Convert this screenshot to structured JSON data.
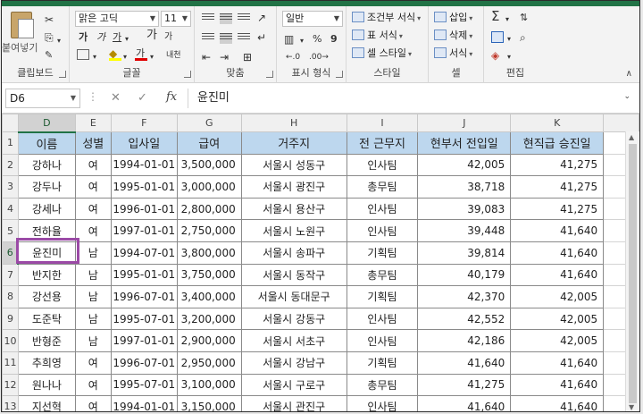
{
  "ribbon": {
    "clipboard": {
      "paste_label": "붙여넣기",
      "cut_icon": "✂",
      "copy_icon": "⎘",
      "painter_icon": "🖌",
      "group_label": "클립보드"
    },
    "font": {
      "font_name": "맑은 고딕",
      "font_size": "11",
      "bold": "가",
      "italic": "가",
      "underline": "가",
      "grow": "가",
      "shrink": "가",
      "font_color_glyph": "가",
      "phonetic": "내천",
      "group_label": "글꼴"
    },
    "alignment": {
      "group_label": "맞춤"
    },
    "number": {
      "format": "일반",
      "percent": "%",
      "comma": "9",
      "currency": "▥",
      "group_label": "표시 형식"
    },
    "styles": {
      "conditional": "조건부 서식",
      "table": "표 서식",
      "cell": "셀 스타일",
      "group_label": "스타일"
    },
    "cells": {
      "insert": "삽입",
      "delete": "삭제",
      "format": "서식",
      "group_label": "셀"
    },
    "editing": {
      "sum": "Σ",
      "sort": "정렬",
      "find": "찾기",
      "group_label": "편집"
    }
  },
  "formula_bar": {
    "name_box": "D6",
    "fx": "fx",
    "value": "윤진미"
  },
  "columns": [
    "D",
    "E",
    "F",
    "G",
    "H",
    "I",
    "J",
    "K"
  ],
  "header_row": [
    "이름",
    "성별",
    "입사일",
    "급여",
    "거주지",
    "전 근무지",
    "현부서 전입일",
    "현직급 승진일"
  ],
  "rows": [
    {
      "num": "1"
    },
    {
      "num": "2",
      "cells": [
        "강하나",
        "여",
        "1994-01-01",
        "3,500,000",
        "서울시 성동구",
        "인사팀",
        "42,005",
        "41,275"
      ]
    },
    {
      "num": "3",
      "cells": [
        "강두나",
        "여",
        "1995-01-01",
        "3,000,000",
        "서울시 광진구",
        "총무팀",
        "38,718",
        "41,275"
      ]
    },
    {
      "num": "4",
      "cells": [
        "강세나",
        "여",
        "1996-01-01",
        "2,800,000",
        "서울시 용산구",
        "인사팀",
        "39,083",
        "41,275"
      ]
    },
    {
      "num": "5",
      "cells": [
        "전하율",
        "여",
        "1997-01-01",
        "2,750,000",
        "서울시 노원구",
        "인사팀",
        "39,448",
        "41,640"
      ]
    },
    {
      "num": "6",
      "cells": [
        "윤진미",
        "남",
        "1994-07-01",
        "3,800,000",
        "서울시 송파구",
        "기획팀",
        "39,814",
        "41,640"
      ]
    },
    {
      "num": "7",
      "cells": [
        "반지한",
        "남",
        "1995-01-01",
        "3,750,000",
        "서울시 동작구",
        "총무팀",
        "40,179",
        "41,640"
      ]
    },
    {
      "num": "8",
      "cells": [
        "강선용",
        "남",
        "1996-07-01",
        "3,400,000",
        "서울시 동대문구",
        "기획팀",
        "42,370",
        "42,005"
      ]
    },
    {
      "num": "9",
      "cells": [
        "도준탁",
        "남",
        "1995-07-01",
        "3,200,000",
        "서울시 강동구",
        "인사팀",
        "42,552",
        "42,005"
      ]
    },
    {
      "num": "10",
      "cells": [
        "반형준",
        "남",
        "1997-01-01",
        "2,900,000",
        "서울시 서초구",
        "인사팀",
        "42,186",
        "42,005"
      ]
    },
    {
      "num": "11",
      "cells": [
        "추희영",
        "여",
        "1996-07-01",
        "2,950,000",
        "서울시 강남구",
        "기획팀",
        "41,640",
        "41,640"
      ]
    },
    {
      "num": "12",
      "cells": [
        "원나나",
        "여",
        "1995-07-01",
        "3,100,000",
        "서울시 구로구",
        "총무팀",
        "41,275",
        "41,640"
      ]
    },
    {
      "num": "13",
      "cells": [
        "지선혁",
        "여",
        "1994-01-01",
        "3,150,000",
        "서울시 관진구",
        "인사팀",
        "41,640",
        "41,640"
      ]
    }
  ],
  "colors": {
    "header_fill": "#bdd7ee",
    "selection_border": "#9b4aa6",
    "excel_green": "#217346"
  },
  "icons": [
    "cut-icon",
    "copy-icon",
    "format-painter-icon",
    "bold-icon",
    "italic-icon",
    "underline-icon",
    "fill-color-icon",
    "font-color-icon",
    "align-icons",
    "wrap-text-icon",
    "merge-icon",
    "percent-icon",
    "sum-icon",
    "sort-icon",
    "find-icon",
    "clear-icon"
  ]
}
